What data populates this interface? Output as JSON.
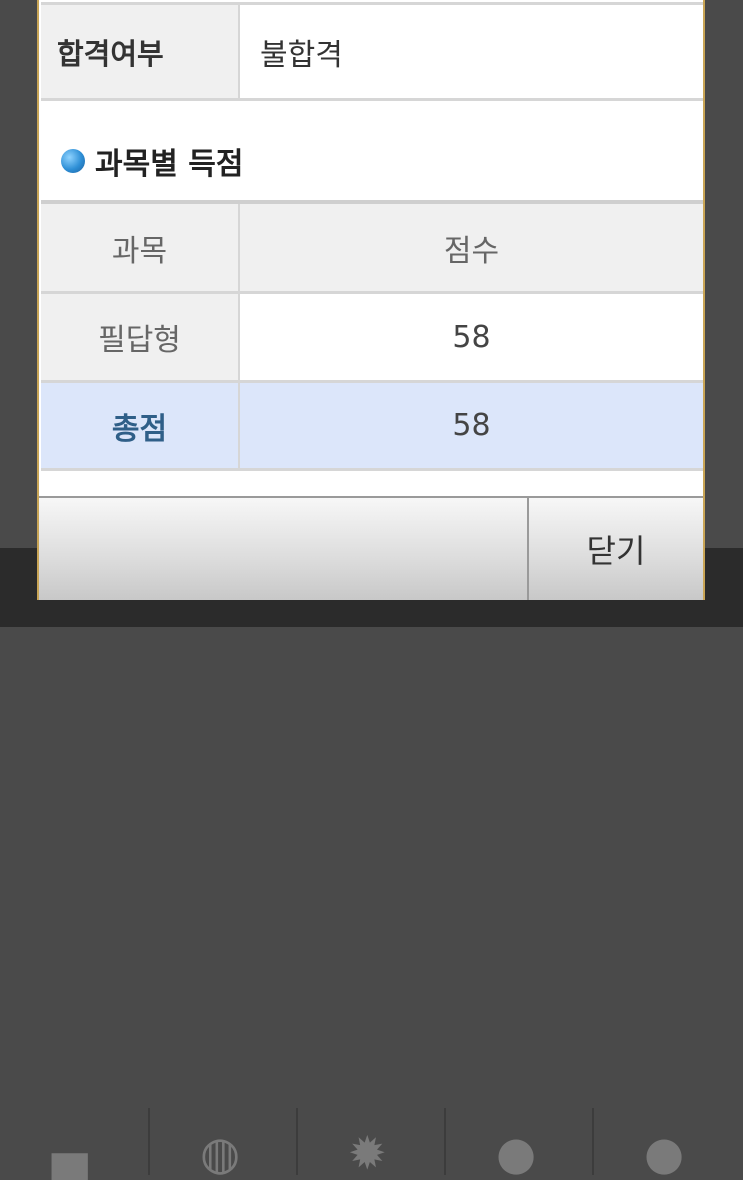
{
  "result": {
    "label": "합격여부",
    "value": "불합격"
  },
  "section": {
    "title": "과목별 득점"
  },
  "score_table": {
    "headers": [
      "과목",
      "점수"
    ],
    "rows": [
      {
        "subject": "필답형",
        "score": "58"
      }
    ],
    "total": {
      "label": "총점",
      "score": "58"
    }
  },
  "buttons": {
    "close_label": "닫기"
  },
  "icons": {
    "bullet": "blue-circle-bullet-icon",
    "background_tab_icons": [
      "home-icon",
      "globe-icon",
      "gear-icon",
      "info-icon",
      "location-icon"
    ]
  },
  "colors": {
    "dialog_border": "#c9a556",
    "total_row_bg": "#dce6fa",
    "total_label": "#2f5f88"
  }
}
